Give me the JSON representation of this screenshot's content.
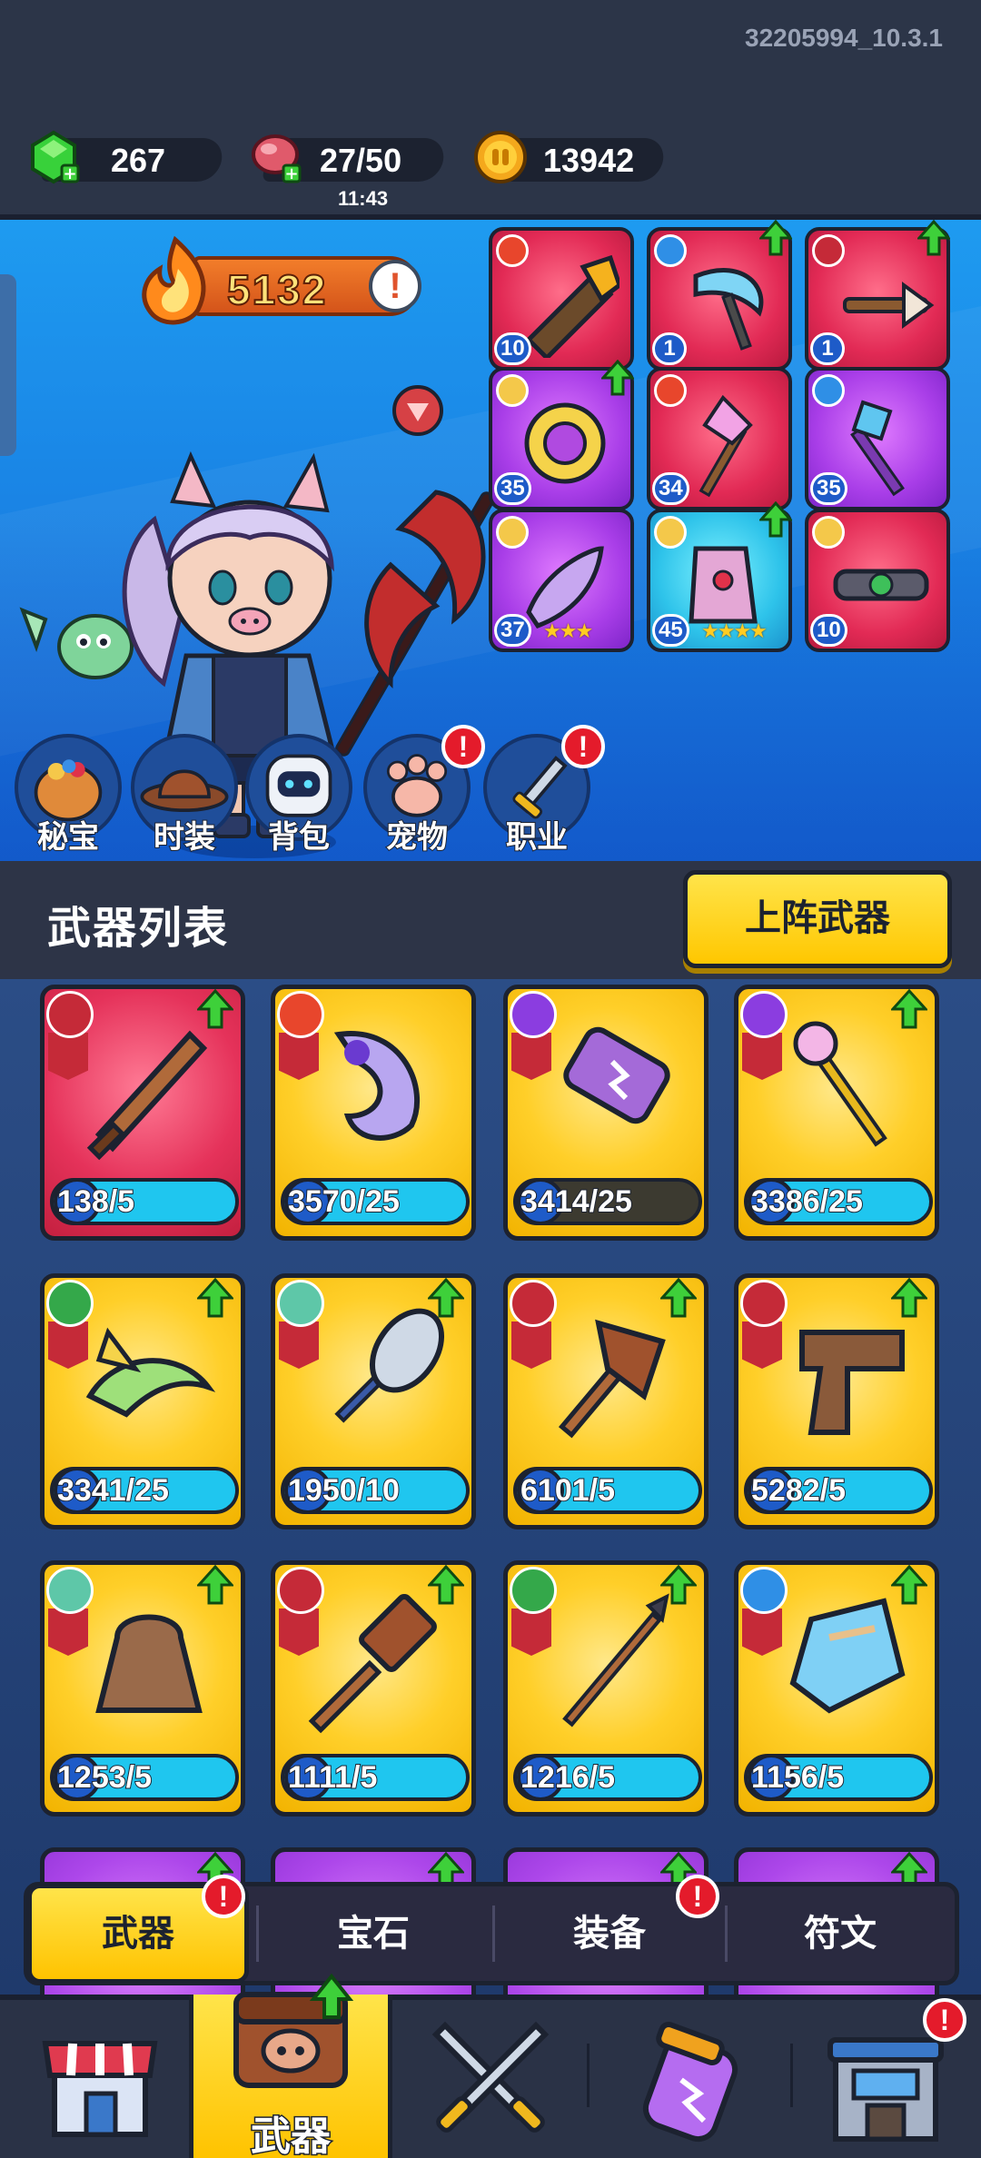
{
  "build_version": "32205994_10.3.1",
  "resources": {
    "gems": "267",
    "stamina": "27/50",
    "stamina_timer": "11:43",
    "coins": "13942"
  },
  "power": {
    "value": "5132",
    "info_icon": "!"
  },
  "equipment": [
    {
      "level": "10",
      "rarity": "red",
      "element": "fire",
      "upgradable": false
    },
    {
      "level": "1",
      "rarity": "red",
      "element": "ice",
      "upgradable": true
    },
    {
      "level": "1",
      "rarity": "red",
      "element": "physical",
      "upgradable": true
    },
    {
      "level": "35",
      "rarity": "purple",
      "element": "holy",
      "upgradable": true
    },
    {
      "level": "34",
      "rarity": "red",
      "element": "fire",
      "upgradable": false
    },
    {
      "level": "35",
      "rarity": "purple",
      "element": "ice",
      "upgradable": false
    },
    {
      "level": "37",
      "rarity": "purple",
      "element": "holy",
      "stars": "★★★",
      "upgradable": false
    },
    {
      "level": "45",
      "rarity": "teal",
      "element": "holy",
      "stars": "★★★★",
      "upgradable": true
    },
    {
      "level": "10",
      "rarity": "red",
      "element": "holy",
      "upgradable": false
    }
  ],
  "menu_buttons": [
    {
      "label": "秘宝",
      "badge": false
    },
    {
      "label": "时装",
      "badge": false
    },
    {
      "label": "背包",
      "badge": false
    },
    {
      "label": "宠物",
      "badge": true
    },
    {
      "label": "职业",
      "badge": true
    }
  ],
  "weapon_list": {
    "title": "武器列表",
    "deploy_button": "上阵武器"
  },
  "weapons": [
    {
      "progress": "138/5",
      "rarity": "red",
      "element": "physical",
      "up": true,
      "bar_dark": false
    },
    {
      "progress": "3570/25",
      "rarity": "gold",
      "element": "fire",
      "up": false,
      "bar_dark": false
    },
    {
      "progress": "3414/25",
      "rarity": "gold",
      "element": "lightning",
      "up": false,
      "bar_dark": true
    },
    {
      "progress": "3386/25",
      "rarity": "gold",
      "element": "lightning",
      "up": true,
      "bar_dark": false
    },
    {
      "progress": "3341/25",
      "rarity": "gold",
      "element": "poison",
      "up": true,
      "bar_dark": false
    },
    {
      "progress": "1950/10",
      "rarity": "gold",
      "element": "wind",
      "up": true,
      "bar_dark": false
    },
    {
      "progress": "6101/5",
      "rarity": "gold",
      "element": "physical",
      "up": true,
      "bar_dark": false
    },
    {
      "progress": "5282/5",
      "rarity": "gold",
      "element": "physical",
      "up": true,
      "bar_dark": false
    },
    {
      "progress": "1253/5",
      "rarity": "gold",
      "element": "wind",
      "up": true,
      "bar_dark": false
    },
    {
      "progress": "1111/5",
      "rarity": "gold",
      "element": "physical",
      "up": true,
      "bar_dark": false
    },
    {
      "progress": "1216/5",
      "rarity": "gold",
      "element": "poison",
      "up": true,
      "bar_dark": false
    },
    {
      "progress": "1156/5",
      "rarity": "gold",
      "element": "ice",
      "up": true,
      "bar_dark": false
    }
  ],
  "category_tabs": [
    {
      "label": "武器",
      "active": true,
      "badge": true
    },
    {
      "label": "宝石",
      "active": false,
      "badge": false
    },
    {
      "label": "装备",
      "active": false,
      "badge": true
    },
    {
      "label": "符文",
      "active": false,
      "badge": false
    }
  ],
  "bottom_nav": [
    {
      "name": "shop",
      "label": ""
    },
    {
      "name": "weapons",
      "label": "武器",
      "active": true
    },
    {
      "name": "battle",
      "label": ""
    },
    {
      "name": "potion",
      "label": ""
    },
    {
      "name": "base",
      "label": "",
      "badge": true
    }
  ],
  "colors": {
    "accent_yellow": "#ffc700",
    "badge_red": "#e41b2b",
    "level_blue": "#1e5bc8",
    "progress_cyan": "#1fc6ef"
  }
}
